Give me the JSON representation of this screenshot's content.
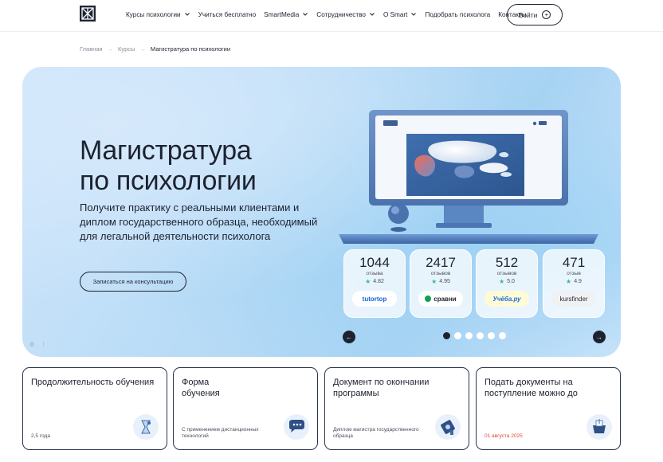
{
  "header": {
    "nav": [
      {
        "label": "Курсы психологии",
        "has_dropdown": true
      },
      {
        "label": "Учиться бесплатно",
        "has_dropdown": false
      },
      {
        "label": "SmartMedia",
        "has_dropdown": true
      },
      {
        "label": "Сотрудничество",
        "has_dropdown": true
      },
      {
        "label": "О Smart",
        "has_dropdown": true
      },
      {
        "label": "Подобрать психолога",
        "has_dropdown": false
      },
      {
        "label": "Контакты",
        "has_dropdown": false
      }
    ],
    "login_label": "Войти"
  },
  "breadcrumb": {
    "items": [
      "Главная",
      "Курсы"
    ],
    "separator": "→",
    "current": "Магистратура по психологии"
  },
  "hero": {
    "title_line1": "Магистратура",
    "title_line2": "по психологии",
    "subtitle": "Получите практику с реальными клиентами и диплом государственного образца, необходимый для легальной деятельности психолога",
    "cta_label": "Записаться на консультацию",
    "reviews": [
      {
        "count": "1044",
        "label": "отзыва",
        "rating": "4.82",
        "brand": "tutortop",
        "brand_color": "#1565d8"
      },
      {
        "count": "2417",
        "label": "отзывов",
        "rating": "4.95",
        "brand": "сравни",
        "brand_color": "#12a150"
      },
      {
        "count": "512",
        "label": "отзывов",
        "rating": "5.0",
        "brand": "Учёба.ру",
        "brand_color": "#1f6fe0"
      },
      {
        "count": "471",
        "label": "отзыв",
        "rating": "4.9",
        "brand": "kursfinder",
        "brand_color": "#2a2f3a"
      }
    ],
    "slider": {
      "total": 6,
      "active": 1
    }
  },
  "info_cards": [
    {
      "title": "Продолжительность обучения",
      "value": "2,5 года",
      "icon": "hourglass-icon"
    },
    {
      "title": "Форма обучения",
      "value": "С применением дистанционных технологий",
      "icon": "chat-bubble-icon"
    },
    {
      "title": "Документ по окончании программы",
      "value": "Диплом магистра государственного образца",
      "icon": "diploma-icon"
    },
    {
      "title": "Подать документы на поступление можно до",
      "value": "01 августа 2025",
      "icon": "inbox-icon",
      "accent": "#e0443a"
    }
  ],
  "colors": {
    "accent_dark": "#1d2230",
    "hero_bg": "#b7dbf6",
    "deadline_red": "#e0443a",
    "rating_star": "#39b7a8"
  }
}
